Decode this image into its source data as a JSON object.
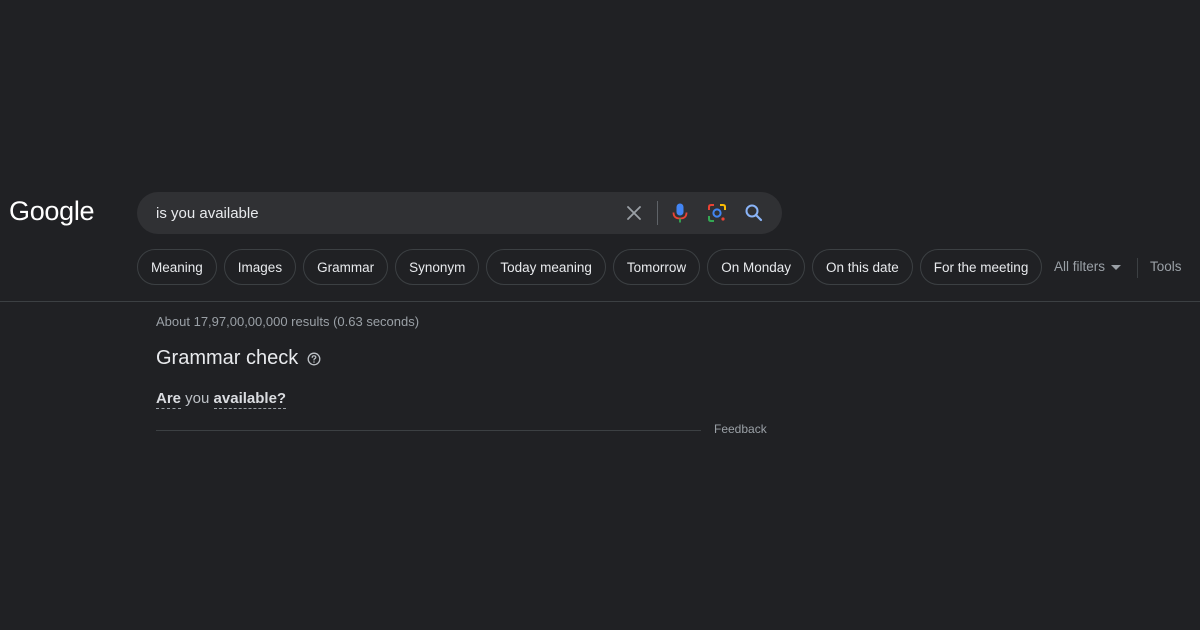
{
  "logo": {
    "text": "Google"
  },
  "search": {
    "query": "is you available",
    "icons": [
      "clear-icon",
      "mic-icon",
      "lens-icon",
      "search-icon"
    ],
    "colors": {
      "mic": "#4285f4",
      "lens_red": "#ea4335",
      "lens_yellow": "#fbbc04",
      "lens_green": "#34a853",
      "lens_blue": "#4285f4",
      "search": "#8ab4f8"
    }
  },
  "chips": [
    {
      "label": "Meaning"
    },
    {
      "label": "Images"
    },
    {
      "label": "Grammar"
    },
    {
      "label": "Synonym"
    },
    {
      "label": "Today meaning"
    },
    {
      "label": "Tomorrow"
    },
    {
      "label": "On Monday"
    },
    {
      "label": "On this date"
    },
    {
      "label": "For the meeting"
    }
  ],
  "filters": {
    "all_filters_label": "All filters",
    "tools_label": "Tools"
  },
  "results": {
    "stats": "About 17,97,00,00,000 results (0.63 seconds)",
    "grammar_check": {
      "title": "Grammar check",
      "correction": [
        {
          "text": "Are",
          "fixed": true
        },
        {
          "text": " you ",
          "fixed": false
        },
        {
          "text": "available?",
          "fixed": true
        }
      ],
      "feedback_label": "Feedback"
    }
  },
  "theme": {
    "background": "#202124",
    "surface": "#303134",
    "border": "#3c4043",
    "text": "#e8eaed",
    "muted": "#9aa0a6"
  }
}
